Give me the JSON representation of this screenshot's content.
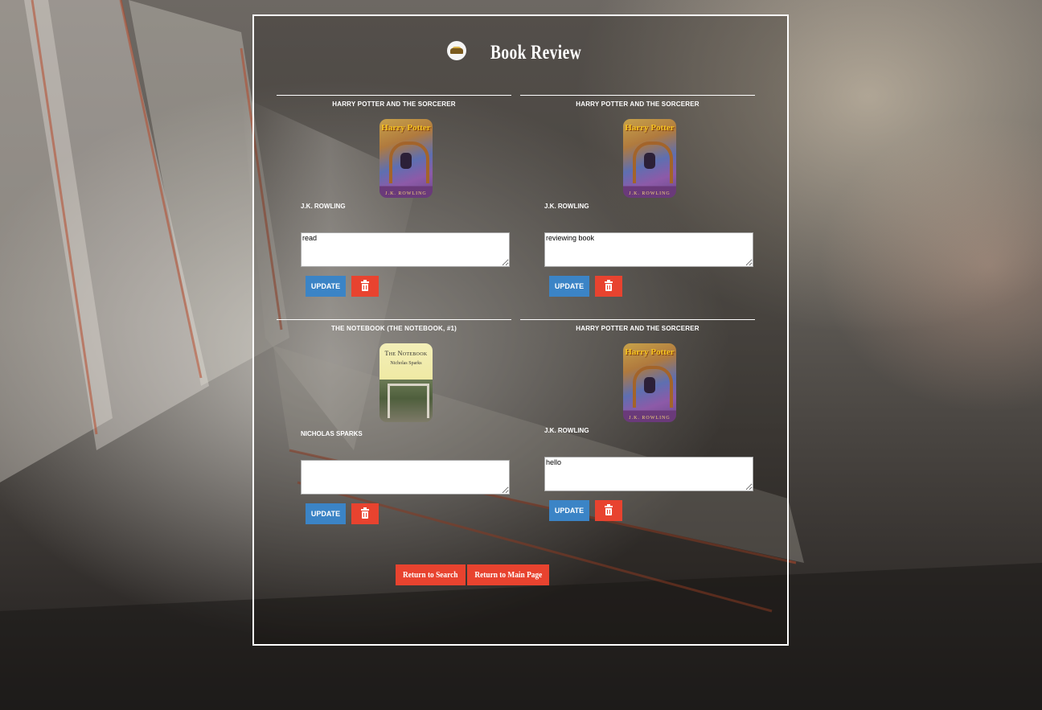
{
  "page": {
    "title": "Book Review"
  },
  "reviews": [
    {
      "book_title": "Harry Potter and the Sorcerer",
      "author": "J.K. Rowling",
      "review_text": "read",
      "cover": {
        "title": "Harry Potter",
        "author": "J.K. ROWLING",
        "style": "harry-potter"
      },
      "update_label": "Update",
      "delete_icon": "trash-icon"
    },
    {
      "book_title": "Harry Potter and the Sorcerer",
      "author": "J.K. Rowling",
      "review_text": "reviewing book",
      "cover": {
        "title": "Harry Potter",
        "author": "J.K. ROWLING",
        "style": "harry-potter"
      },
      "update_label": "Update",
      "delete_icon": "trash-icon"
    },
    {
      "book_title": "The Notebook (The Notebook, #1)",
      "author": "Nicholas Sparks",
      "review_text": "",
      "cover": {
        "title": "The Notebook",
        "author": "Nicholas Sparks",
        "style": "notebook"
      },
      "update_label": "Update",
      "delete_icon": "trash-icon"
    },
    {
      "book_title": "Harry Potter and the Sorcerer",
      "author": "J.K. Rowling",
      "review_text": "hello",
      "cover": {
        "title": "Harry Potter",
        "author": "J.K. ROWLING",
        "style": "harry-potter"
      },
      "update_label": "Update",
      "delete_icon": "trash-icon"
    }
  ],
  "nav": {
    "return_search": "Return to Search",
    "return_main": "Return to Main Page"
  },
  "colors": {
    "update_button": "#3b84c6",
    "delete_button": "#e8432f",
    "nav_button": "#e8432f",
    "panel_border": "#ffffff"
  }
}
